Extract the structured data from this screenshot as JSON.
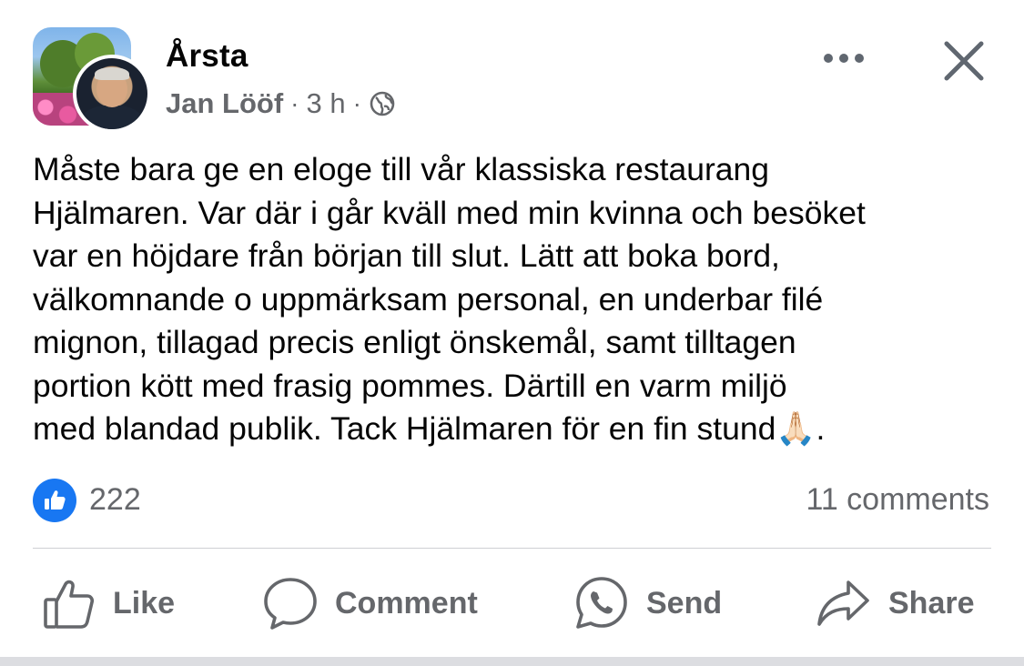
{
  "header": {
    "group_name": "Årsta",
    "author_name": "Jan Lööf",
    "separator": "·",
    "time": "3 h",
    "privacy_icon": "globe-icon"
  },
  "post": {
    "text": "Måste bara ge en eloge till vår klassiska restaurang\nHjälmaren. Var där i går kväll med min kvinna och besöket\nvar en höjdare från början till slut. Lätt att boka bord,\nvälkomnande o uppmärksam personal, en underbar filé\nmignon, tillagad precis enligt önskemål, samt tilltagen\nportion kött med frasig pommes. Därtill en varm miljö\nmed blandad publik. Tack Hjälmaren för en fin stund🙏🏻."
  },
  "stats": {
    "reactions": "222",
    "comments": "11 comments"
  },
  "actions": {
    "like": "Like",
    "comment": "Comment",
    "send": "Send",
    "share": "Share"
  },
  "colors": {
    "accent": "#1877f2",
    "secondary_text": "#65676b",
    "primary_text": "#050505",
    "divider": "#ced0d4"
  }
}
